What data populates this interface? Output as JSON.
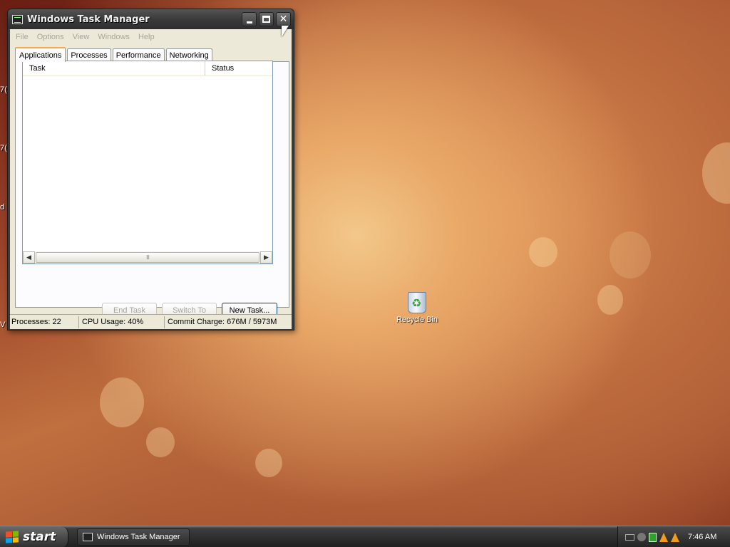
{
  "window": {
    "title": "Windows Task Manager",
    "menu": [
      "File",
      "Options",
      "View",
      "Windows",
      "Help"
    ],
    "tabs": [
      "Applications",
      "Processes",
      "Performance",
      "Networking"
    ],
    "active_tab": "Applications",
    "columns": {
      "task": "Task",
      "status": "Status"
    },
    "scroll_thumb_grip": "III",
    "buttons": {
      "end_task": "End Task",
      "switch_to": "Switch To",
      "new_task": "New Task..."
    },
    "status": {
      "processes": "Processes: 22",
      "cpu": "CPU Usage: 40%",
      "commit": "Commit Charge: 676M / 5973M"
    }
  },
  "desktop": {
    "recycle_bin_label": "Recycle Bin",
    "edge_fragments": [
      "7(",
      "7(",
      "d",
      "V"
    ]
  },
  "taskbar": {
    "start_label": "start",
    "task_button_label": "Windows Task Manager",
    "clock": "7:46 AM"
  },
  "icons": [
    "monitor-icon",
    "minimize-icon",
    "maximize-icon",
    "close-icon",
    "recycle-bin-icon",
    "windows-flag-icon",
    "keyboard-icon",
    "security-icon",
    "network-icon",
    "vlc-icon"
  ]
}
